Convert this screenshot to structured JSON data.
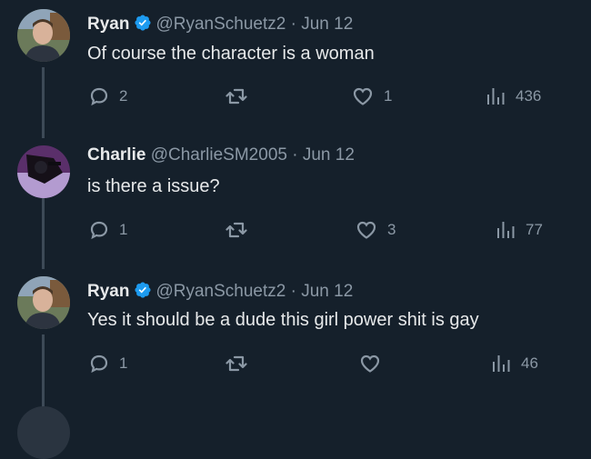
{
  "colors": {
    "background": "#15202b",
    "verified": "#1d9bf0",
    "muted": "#8b98a5",
    "text": "#e7e9ea"
  },
  "tweets": [
    {
      "name": "Ryan",
      "verified": true,
      "handle": "@RyanSchuetz2",
      "separator": "·",
      "date": "Jun 12",
      "text": "Of course the character is a woman",
      "replies": "2",
      "retweets": "",
      "likes": "1",
      "views": "436"
    },
    {
      "name": "Charlie",
      "verified": false,
      "handle": "@CharlieSM2005",
      "separator": "·",
      "date": "Jun 12",
      "text": "is there a issue?",
      "replies": "1",
      "retweets": "",
      "likes": "3",
      "views": "77"
    },
    {
      "name": "Ryan",
      "verified": true,
      "handle": "@RyanSchuetz2",
      "separator": "·",
      "date": "Jun 12",
      "text": "Yes it should be a dude this girl power shit is gay",
      "replies": "1",
      "retweets": "",
      "likes": "",
      "views": "46"
    }
  ],
  "icons": {
    "reply": "reply-icon",
    "retweet": "retweet-icon",
    "like": "heart-icon",
    "views": "views-icon",
    "verified": "verified-badge-icon"
  }
}
